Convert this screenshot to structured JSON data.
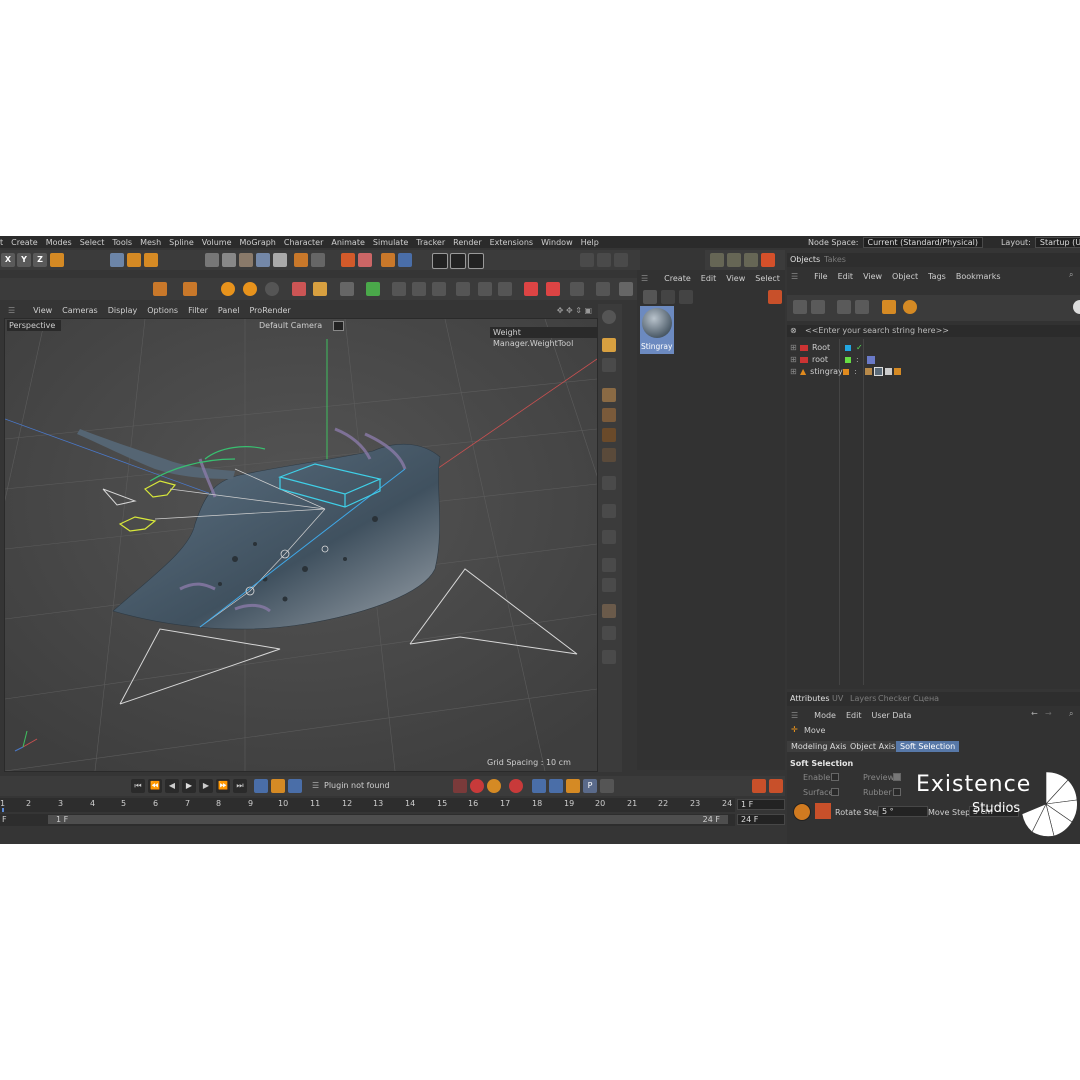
{
  "menubar": {
    "items": [
      "t",
      "Create",
      "Modes",
      "Select",
      "Tools",
      "Mesh",
      "Spline",
      "Volume",
      "MoGraph",
      "Character",
      "Animate",
      "Simulate",
      "Tracker",
      "Render",
      "Extensions",
      "Window",
      "Help"
    ],
    "node_space_label": "Node Space:",
    "node_space_value": "Current (Standard/Physical)",
    "layout_label": "Layout:",
    "layout_value": "Startup (User)"
  },
  "axis_buttons": [
    "X",
    "Y",
    "Z"
  ],
  "viewport": {
    "menu": [
      "View",
      "Cameras",
      "Display",
      "Options",
      "Filter",
      "Panel",
      "ProRender"
    ],
    "view_name": "Perspective",
    "camera": "Default Camera",
    "tool": "Weight Manager.WeightTool",
    "grid_spacing": "Grid Spacing : 10 cm"
  },
  "materials": {
    "menu": [
      "Create",
      "Edit",
      "View",
      "Select"
    ],
    "items": [
      {
        "name": "Stingray"
      }
    ]
  },
  "objects_panel": {
    "tabs": [
      "Objects",
      "Takes"
    ],
    "menu": [
      "File",
      "Edit",
      "View",
      "Object",
      "Tags",
      "Bookmarks"
    ],
    "search_placeholder": "<<Enter your search string here>>",
    "rows": [
      {
        "name": "Root",
        "color": "#22a6e0"
      },
      {
        "name": "root",
        "color": "#66dd44"
      },
      {
        "name": "stingray",
        "color": "#e08a1e"
      }
    ]
  },
  "attributes": {
    "tabs": [
      "Attributes",
      "UV",
      "Layers",
      "Checker",
      "Сцена"
    ],
    "menu": [
      "Mode",
      "Edit",
      "User Data"
    ],
    "tool_title": "Move",
    "subtabs": [
      "Modeling Axis",
      "Object Axis",
      "Soft Selection"
    ],
    "active_subtab": "Soft Selection",
    "section": "Soft Selection",
    "enable_label": "Enable",
    "preview_label": "Preview",
    "surface_label": "Surface",
    "rubber_label": "Rubber",
    "rotate_step_label": "Rotate Step",
    "rotate_step_value": "5 °",
    "move_step_label": "Move Step",
    "move_step_value": "5 cm"
  },
  "playback": {
    "status": "Plugin not found"
  },
  "timeline": {
    "ticks": [
      "1",
      "2",
      "3",
      "4",
      "5",
      "6",
      "7",
      "8",
      "9",
      "10",
      "11",
      "12",
      "13",
      "14",
      "15",
      "16",
      "17",
      "18",
      "19",
      "20",
      "21",
      "22",
      "23",
      "24"
    ],
    "current_frame": "1 F",
    "start_field": "F",
    "range_start": "1 F",
    "range_end": "24 F",
    "end_field": "24 F"
  },
  "watermark": {
    "line1": "Existence",
    "line2": "Studios"
  }
}
